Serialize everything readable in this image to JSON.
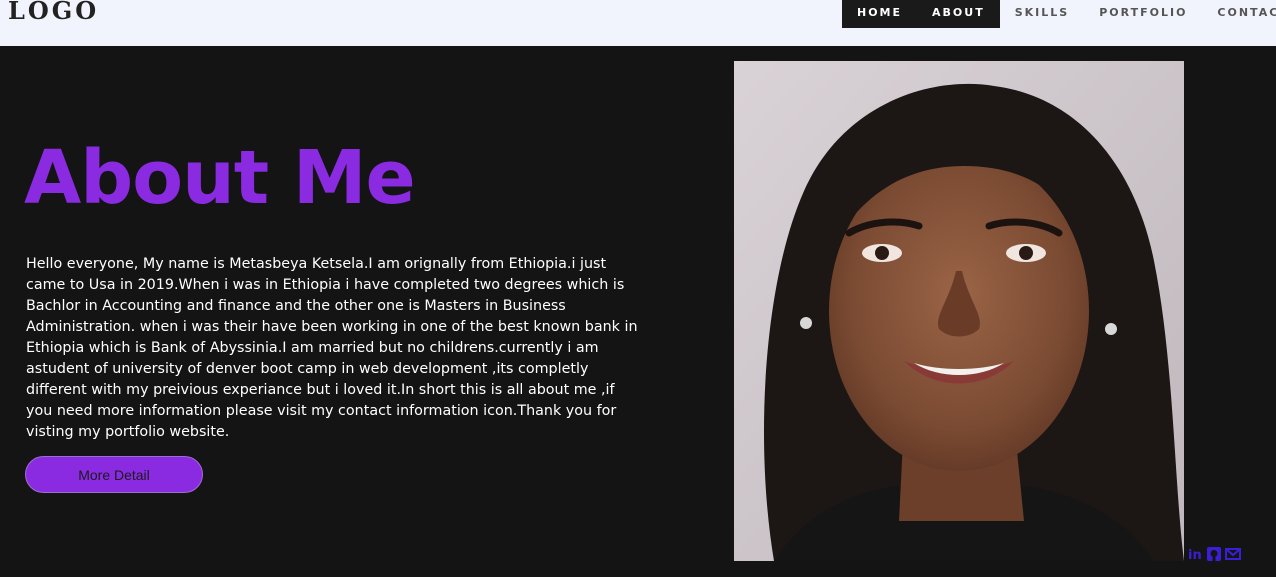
{
  "header": {
    "logo": "LOGO",
    "nav": [
      {
        "label": "HOME"
      },
      {
        "label": "ABOUT"
      },
      {
        "label": "SKILLS"
      },
      {
        "label": "PORTFOLIO"
      },
      {
        "label": "CONTACT"
      }
    ]
  },
  "about": {
    "heading": "About Me",
    "bio": "Hello everyone, My name is Metasbeya Ketsela.I am orignally from Ethiopia.i just came to Usa in 2019.When i was in Ethiopia i have completed two degrees which is Bachlor in Accounting and finance and the other one is Masters in Business Administration. when i was their have been working in one of the best known bank in Ethiopia which is Bank of Abyssinia.I am married but no childrens.currently i am astudent of university of denver boot camp in web development ,its completly different with my preivious experiance but i loved it.In short this is all about me ,if you need more information please visit my contact information icon.Thank you for visting my portfolio website.",
    "button_label": "More Detail"
  },
  "social": {
    "icons": [
      "linkedin-icon",
      "github-icon",
      "email-icon"
    ]
  },
  "colors": {
    "accent": "#8a2be2",
    "background": "#141414",
    "header_bg": "#f2f4fd",
    "social_icon": "#3a1fd6"
  }
}
